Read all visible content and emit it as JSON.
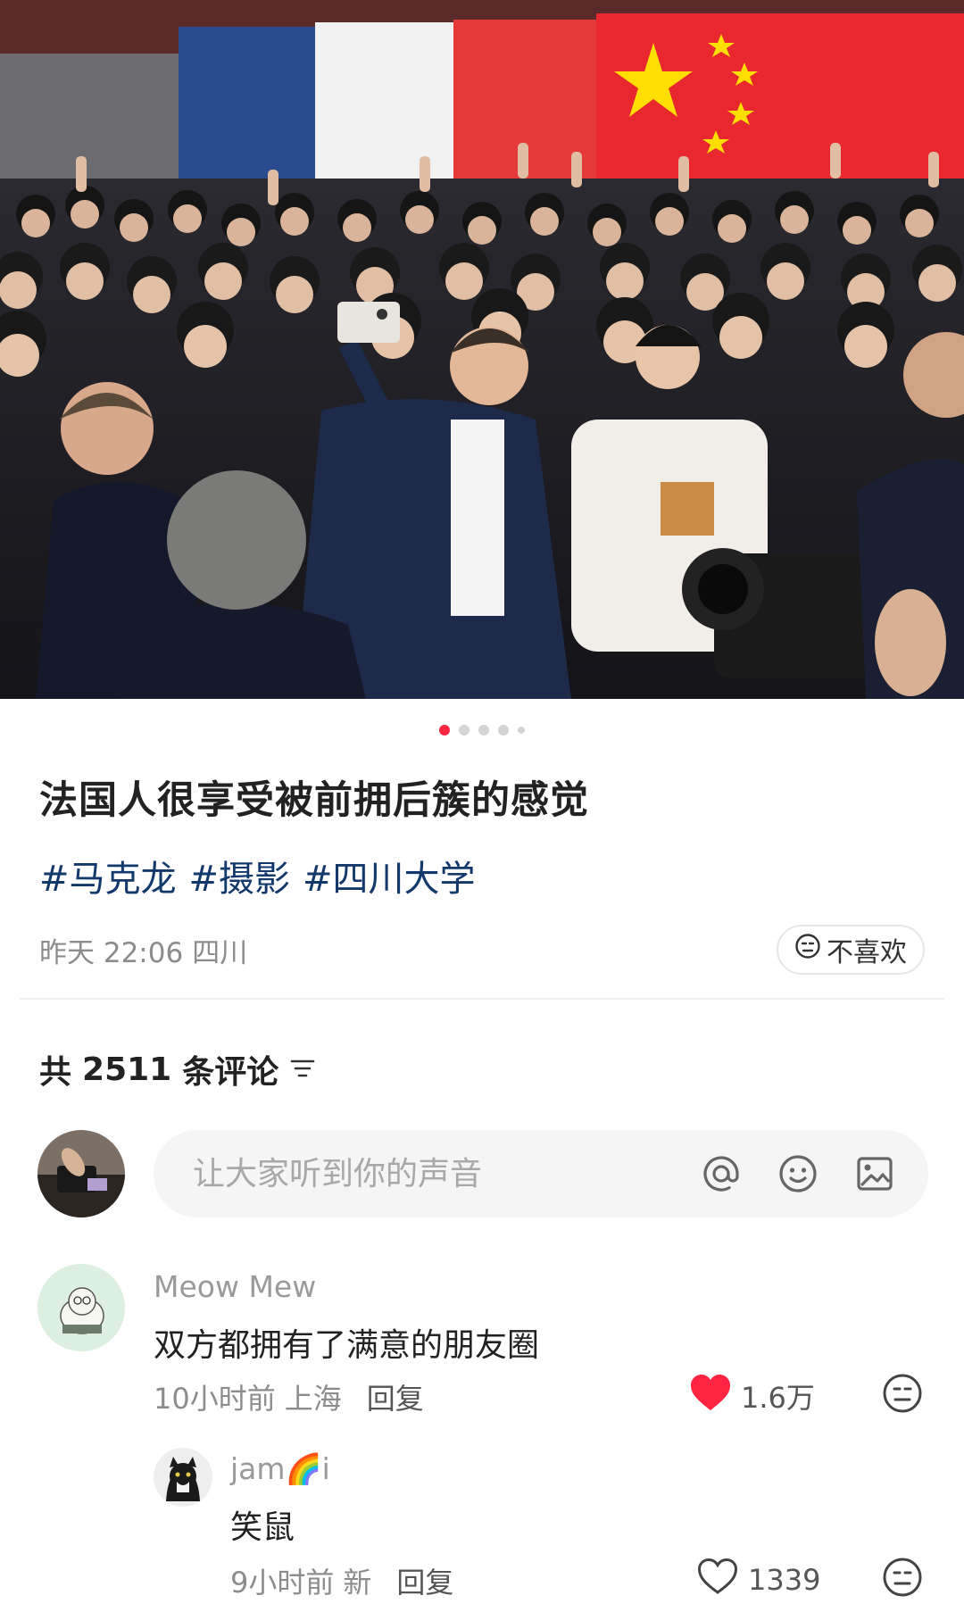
{
  "post": {
    "image_pagination": {
      "total": 5,
      "active": 1
    },
    "title": "法国人很享受被前拥后簇的感觉",
    "tags": [
      "#马克龙",
      "#摄影",
      "#四川大学"
    ],
    "date": "昨天 22:06",
    "location": "四川",
    "dislike_label": "不喜欢"
  },
  "comments_section": {
    "prefix": "共",
    "count": "2511",
    "suffix": "条评论",
    "input_placeholder": "让大家听到你的声音"
  },
  "comments": [
    {
      "user": "Meow Mew",
      "text": "双方都拥有了满意的朋友圈",
      "time": "10小时前",
      "location": "上海",
      "reply_label": "回复",
      "likes": "1.6万",
      "liked": true
    },
    {
      "user": "jam🌈i",
      "text": "笑鼠",
      "time": "9小时前",
      "location": "新",
      "reply_label": "回复",
      "likes": "1339",
      "liked": false
    }
  ],
  "colors": {
    "accent_red": "#ff2442",
    "tag_blue": "#13386c",
    "flag_red": "#e8272f",
    "flag_yellow": "#ffde00",
    "flag_blue": "#1e3f8a"
  },
  "icons": [
    "at-icon",
    "emoji-icon",
    "image-icon",
    "sort-icon",
    "heart-icon",
    "dislike-face-icon"
  ]
}
